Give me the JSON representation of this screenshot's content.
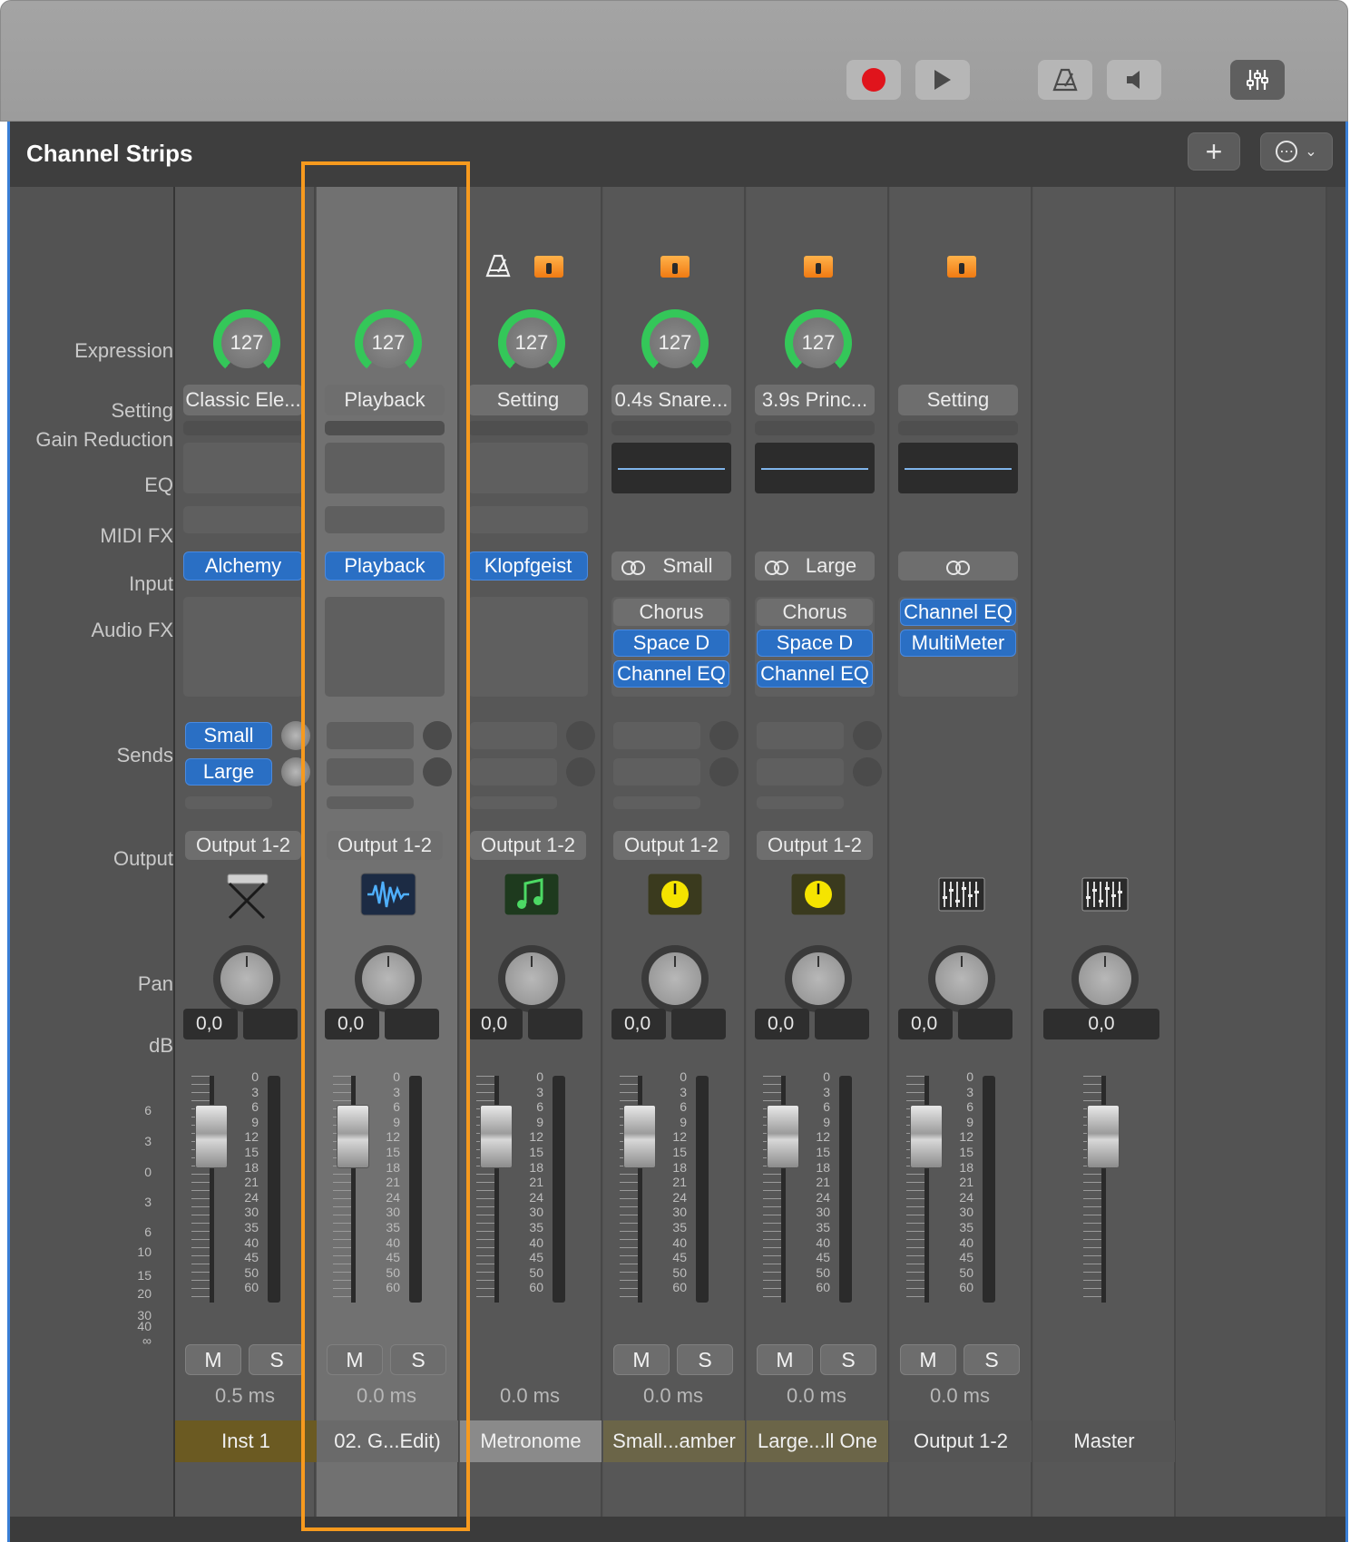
{
  "toolbar": {
    "buttons": [
      {
        "name": "record-button",
        "icon": "record-icon"
      },
      {
        "name": "play-button",
        "icon": "play-icon"
      },
      {
        "name": "metronome-button",
        "icon": "metronome-icon"
      },
      {
        "name": "count-in-button",
        "icon": "speaker-icon"
      },
      {
        "name": "mixer-button",
        "icon": "mixer-sliders-icon"
      }
    ]
  },
  "window": {
    "title": "Channel Strips",
    "add_label": "+",
    "more_label": "⋯"
  },
  "rows": {
    "expression": "Expression",
    "setting": "Setting",
    "gain_reduction": "Gain Reduction",
    "eq": "EQ",
    "midi_fx": "MIDI FX",
    "input": "Input",
    "audio_fx": "Audio FX",
    "sends": "Sends",
    "output": "Output",
    "pan": "Pan",
    "db": "dB"
  },
  "fader_scale_left": [
    "6",
    "3",
    "0",
    "3",
    "6",
    "10",
    "15",
    "20",
    "30",
    "40",
    "∞"
  ],
  "meter_scale": [
    "0",
    "3",
    "6",
    "9",
    "12",
    "15",
    "18",
    "21",
    "24",
    "30",
    "35",
    "40",
    "45",
    "50",
    "60"
  ],
  "strips": [
    {
      "name": "Inst 1",
      "top_icons": [],
      "expression": "127",
      "setting": "Classic Ele...",
      "eq": "empty",
      "midi_fx": true,
      "input": {
        "label": "Alchemy",
        "style": "blue",
        "link": false
      },
      "audio_fx": [],
      "sends": [
        {
          "label": "Small"
        },
        {
          "label": "Large"
        }
      ],
      "output": "Output 1-2",
      "track_icon": "keyboard-icon",
      "pan_value": "0,0",
      "peak": "",
      "latency": "0.5 ms",
      "mute": "M",
      "solo": "S",
      "name_color": "#6b5a22",
      "selected": false
    },
    {
      "name": "02. G...Edit)",
      "top_icons": [],
      "expression": "127",
      "setting": "Playback",
      "eq": "empty",
      "midi_fx": true,
      "input": {
        "label": "Playback",
        "style": "blue",
        "link": false
      },
      "audio_fx": [],
      "sends": [],
      "output": "Output 1-2",
      "track_icon": "waveform-icon",
      "pan_value": "0,0",
      "peak": "",
      "latency": "0.0 ms",
      "mute": "M",
      "solo": "S",
      "name_color": "#6a6a6a",
      "selected": true
    },
    {
      "name": "Metronome",
      "top_icons": [
        "metronome-icon",
        "folder-icon"
      ],
      "expression": "127",
      "setting": "Setting",
      "eq": "empty",
      "midi_fx": true,
      "input": {
        "label": "Klopfgeist",
        "style": "blue",
        "link": false
      },
      "audio_fx": [],
      "sends": [],
      "output": "Output 1-2",
      "track_icon": "music-note-icon",
      "pan_value": "0,0",
      "peak": "",
      "latency": "0.0 ms",
      "mute": "",
      "solo": "",
      "name_color": "#8a8a8a",
      "selected": false
    },
    {
      "name": "Small...amber",
      "top_icons": [
        "folder-icon"
      ],
      "expression": "127",
      "setting": "0.4s Snare...",
      "eq": "curve",
      "midi_fx": false,
      "input": {
        "label": "Small",
        "style": "grey",
        "link": true
      },
      "audio_fx": [
        {
          "label": "Chorus",
          "style": "grey"
        },
        {
          "label": "Space D",
          "style": "blue"
        },
        {
          "label": "Channel EQ",
          "style": "blue"
        }
      ],
      "sends": [],
      "output": "Output 1-2",
      "track_icon": "aux-knob-icon",
      "pan_value": "0,0",
      "peak": "",
      "latency": "0.0 ms",
      "mute": "M",
      "solo": "S",
      "name_color": "#6b6548",
      "selected": false
    },
    {
      "name": "Large...ll One",
      "top_icons": [
        "folder-icon"
      ],
      "expression": "127",
      "setting": "3.9s Princ...",
      "eq": "curve",
      "midi_fx": false,
      "input": {
        "label": "Large",
        "style": "grey",
        "link": true
      },
      "audio_fx": [
        {
          "label": "Chorus",
          "style": "grey"
        },
        {
          "label": "Space D",
          "style": "blue"
        },
        {
          "label": "Channel EQ",
          "style": "blue"
        }
      ],
      "sends": [],
      "output": "Output 1-2",
      "track_icon": "aux-knob-icon",
      "pan_value": "0,0",
      "peak": "",
      "latency": "0.0 ms",
      "mute": "M",
      "solo": "S",
      "name_color": "#6b6548",
      "selected": false
    },
    {
      "name": "Output 1-2",
      "top_icons": [
        "folder-icon"
      ],
      "expression": "",
      "setting": "Setting",
      "eq": "curve",
      "midi_fx": false,
      "input": {
        "label": "",
        "style": "grey",
        "link": true
      },
      "audio_fx": [
        {
          "label": "Channel EQ",
          "style": "blue"
        },
        {
          "label": "MultiMeter",
          "style": "blue"
        }
      ],
      "sends": [],
      "output": "",
      "track_icon": "mixer-icon",
      "pan_value": "0,0",
      "peak": "",
      "latency": "0.0 ms",
      "mute": "M",
      "solo": "S",
      "name_color": "#555555",
      "selected": false
    },
    {
      "name": "Master",
      "top_icons": [],
      "expression": "",
      "setting": "",
      "eq": "none",
      "midi_fx": false,
      "input": null,
      "audio_fx": null,
      "sends": [],
      "output": "",
      "track_icon": "mixer-icon",
      "pan_value": "0,0",
      "peak": null,
      "latency": "",
      "mute": "",
      "solo": "",
      "name_color": "#555555",
      "selected": false
    }
  ],
  "colors": {
    "accent_blue": "#2a6fc4",
    "selection_orange": "#f79a1e",
    "expression_ring": "#34c759",
    "record_red": "#e0141c"
  }
}
